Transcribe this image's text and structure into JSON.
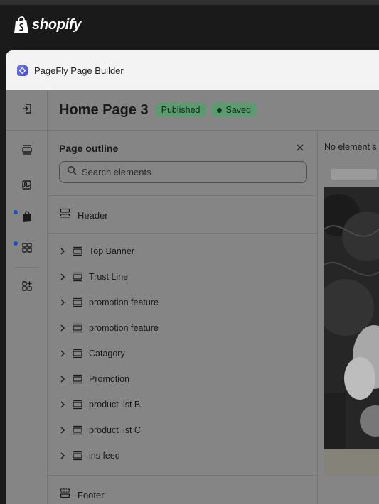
{
  "shopify": {
    "brand": "shopify"
  },
  "app": {
    "name": "PageFly Page Builder"
  },
  "header": {
    "page_title": "Home Page 3",
    "status_published": "Published",
    "status_saved": "Saved"
  },
  "rail": {
    "icons": [
      "exit-icon",
      "sections-icon",
      "media-icon",
      "shopify-bag-icon",
      "apps-grid-icon",
      "add-app-icon"
    ]
  },
  "outline": {
    "title": "Page outline",
    "search_placeholder": "Search elements",
    "header_label": "Header",
    "footer_label": "Footer",
    "sections": [
      {
        "label": "Top Banner"
      },
      {
        "label": "Trust Line"
      },
      {
        "label": "promotion feature"
      },
      {
        "label": "promotion feature"
      },
      {
        "label": "Catagory"
      },
      {
        "label": "Promotion"
      },
      {
        "label": "product list B"
      },
      {
        "label": "product list C"
      },
      {
        "label": "ins feed"
      }
    ]
  },
  "canvas": {
    "message": "No element s"
  },
  "colors": {
    "shopify_bar": "#1a1a1a",
    "overlay": "#858585",
    "badge_green": "#5c9b70",
    "notification_dot": "#1c4fc4"
  }
}
